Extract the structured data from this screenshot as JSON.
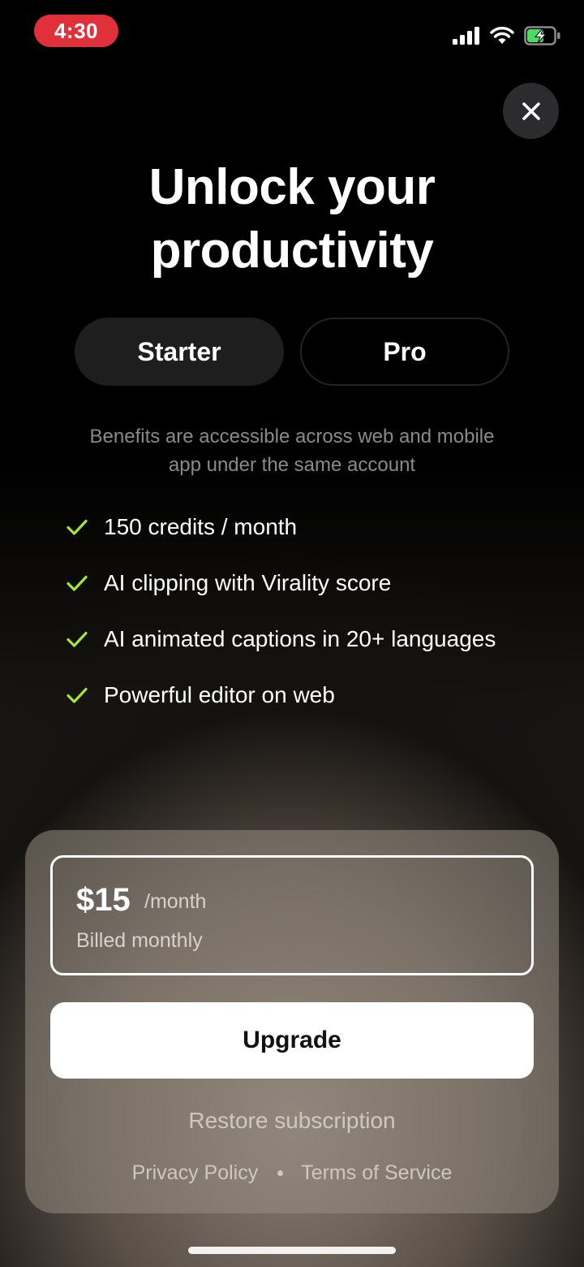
{
  "status_bar": {
    "time": "4:30"
  },
  "header": {
    "title_line1": "Unlock your",
    "title_line2": "productivity"
  },
  "plan_tabs": [
    {
      "label": "Starter",
      "selected": true
    },
    {
      "label": "Pro",
      "selected": false
    }
  ],
  "subtitle_line1": "Benefits are accessible across web and mobile",
  "subtitle_line2": "app under the same account",
  "benefits": [
    {
      "text": "150 credits / month"
    },
    {
      "text": "AI clipping with Virality score"
    },
    {
      "text": "AI animated captions in 20+ languages"
    },
    {
      "text": "Powerful editor on web"
    }
  ],
  "pricing": {
    "price": "$15",
    "period": "/month",
    "billing": "Billed monthly"
  },
  "actions": {
    "upgrade_label": "Upgrade",
    "restore_label": "Restore subscription",
    "privacy_label": "Privacy Policy",
    "terms_label": "Terms of Service"
  },
  "colors": {
    "check": "#a3e635",
    "time_pill": "#e0303a",
    "battery_charging": "#4cd964"
  },
  "icons": {
    "close": "close-icon",
    "check": "check-icon",
    "signal": "cellular-signal-icon",
    "wifi": "wifi-icon",
    "battery": "battery-charging-icon"
  }
}
